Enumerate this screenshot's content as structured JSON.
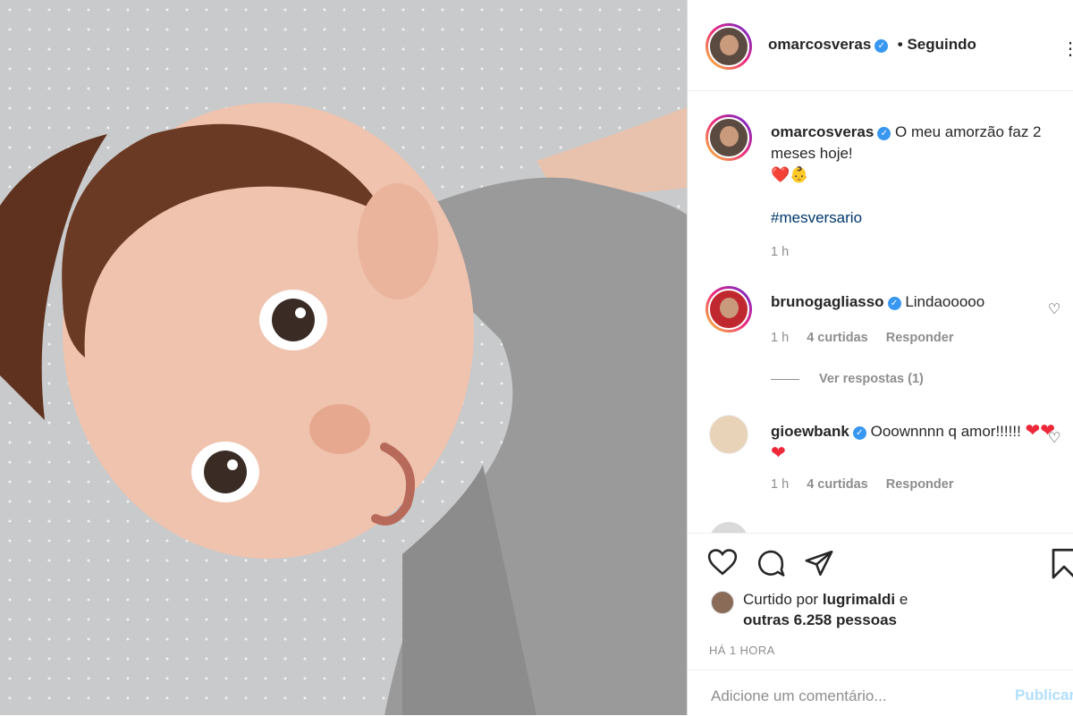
{
  "post": {
    "author": "omarcosveras",
    "follow_status": "• Seguindo",
    "more_label": "⋮"
  },
  "caption": {
    "author": "omarcosveras",
    "text": "O meu amorzão faz 2 meses hoje!",
    "emojis": "❤️👶",
    "hashtag": "#mesversario",
    "time": "1 h"
  },
  "comments": [
    {
      "author": "brunogagliasso",
      "text": "Lindaooooo",
      "time": "1 h",
      "likes": "4 curtidas",
      "reply": "Responder",
      "view_replies": "Ver respostas (1)"
    },
    {
      "author": "gioewbank",
      "text": "Ooownnnn q amor!!!!!! ",
      "hearts": "❤❤❤",
      "time": "1 h",
      "likes": "4 curtidas",
      "reply": "Responder"
    }
  ],
  "likes": {
    "prefix": "Curtido por",
    "user": "lugrimaldi",
    "connector": "e",
    "others": "outras 6.258 pessoas"
  },
  "timestamp": "HÁ 1 HORA",
  "add_comment": {
    "placeholder": "Adicione um comentário...",
    "post_label": "Publicar"
  },
  "icons": [
    "heart-icon",
    "comment-icon",
    "share-icon",
    "bookmark-icon",
    "verified-icon"
  ],
  "colors": {
    "verified": "#3897f0",
    "hashtag": "#00376b",
    "heart": "#ed2839",
    "post_button": "#b2dffc"
  }
}
